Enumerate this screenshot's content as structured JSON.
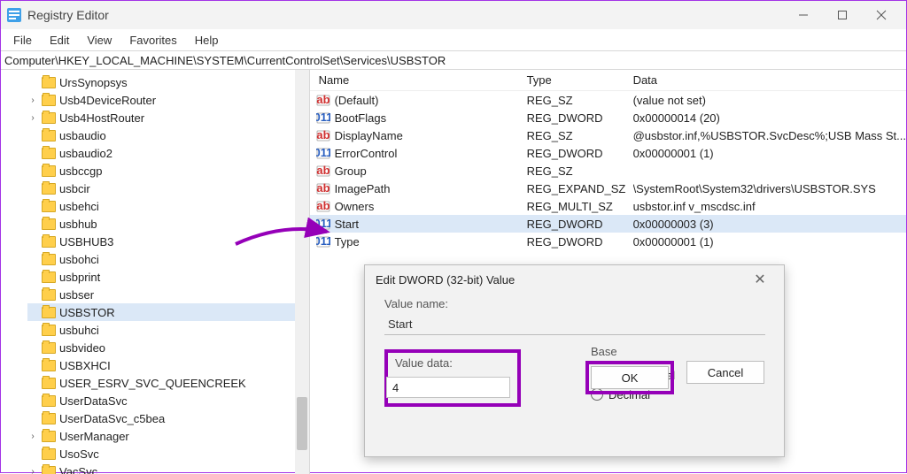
{
  "window": {
    "title": "Registry Editor",
    "menu": [
      "File",
      "Edit",
      "View",
      "Favorites",
      "Help"
    ],
    "address": "Computer\\HKEY_LOCAL_MACHINE\\SYSTEM\\CurrentControlSet\\Services\\USBSTOR"
  },
  "tree": {
    "items": [
      {
        "exp": false,
        "name": "UrsSynopsys"
      },
      {
        "exp": true,
        "name": "Usb4DeviceRouter"
      },
      {
        "exp": true,
        "name": "Usb4HostRouter"
      },
      {
        "exp": false,
        "name": "usbaudio"
      },
      {
        "exp": false,
        "name": "usbaudio2"
      },
      {
        "exp": false,
        "name": "usbccgp"
      },
      {
        "exp": false,
        "name": "usbcir"
      },
      {
        "exp": false,
        "name": "usbehci"
      },
      {
        "exp": false,
        "name": "usbhub"
      },
      {
        "exp": false,
        "name": "USBHUB3"
      },
      {
        "exp": false,
        "name": "usbohci"
      },
      {
        "exp": false,
        "name": "usbprint"
      },
      {
        "exp": false,
        "name": "usbser"
      },
      {
        "exp": false,
        "name": "USBSTOR",
        "selected": true
      },
      {
        "exp": false,
        "name": "usbuhci"
      },
      {
        "exp": false,
        "name": "usbvideo"
      },
      {
        "exp": false,
        "name": "USBXHCI"
      },
      {
        "exp": false,
        "name": "USER_ESRV_SVC_QUEENCREEK"
      },
      {
        "exp": false,
        "name": "UserDataSvc"
      },
      {
        "exp": false,
        "name": "UserDataSvc_c5bea"
      },
      {
        "exp": true,
        "name": "UserManager"
      },
      {
        "exp": false,
        "name": "UsoSvc"
      },
      {
        "exp": true,
        "name": "VacSvc"
      }
    ]
  },
  "list": {
    "headers": {
      "name": "Name",
      "type": "Type",
      "data": "Data"
    },
    "rows": [
      {
        "ico": "sz",
        "name": "(Default)",
        "type": "REG_SZ",
        "data": "(value not set)"
      },
      {
        "ico": "dw",
        "name": "BootFlags",
        "type": "REG_DWORD",
        "data": "0x00000014 (20)"
      },
      {
        "ico": "sz",
        "name": "DisplayName",
        "type": "REG_SZ",
        "data": "@usbstor.inf,%USBSTOR.SvcDesc%;USB Mass St..."
      },
      {
        "ico": "dw",
        "name": "ErrorControl",
        "type": "REG_DWORD",
        "data": "0x00000001 (1)"
      },
      {
        "ico": "sz",
        "name": "Group",
        "type": "REG_SZ",
        "data": ""
      },
      {
        "ico": "sz",
        "name": "ImagePath",
        "type": "REG_EXPAND_SZ",
        "data": "\\SystemRoot\\System32\\drivers\\USBSTOR.SYS"
      },
      {
        "ico": "sz",
        "name": "Owners",
        "type": "REG_MULTI_SZ",
        "data": "usbstor.inf v_mscdsc.inf"
      },
      {
        "ico": "dw",
        "name": "Start",
        "type": "REG_DWORD",
        "data": "0x00000003 (3)",
        "selected": true
      },
      {
        "ico": "dw",
        "name": "Type",
        "type": "REG_DWORD",
        "data": "0x00000001 (1)"
      }
    ]
  },
  "dialog": {
    "title": "Edit DWORD (32-bit) Value",
    "value_name_label": "Value name:",
    "value_name": "Start",
    "value_data_label": "Value data:",
    "value_data": "4",
    "base_label": "Base",
    "base_options": {
      "hex": "Hexadecimal",
      "dec": "Decimal"
    },
    "base_selected": "hex",
    "buttons": {
      "ok": "OK",
      "cancel": "Cancel"
    }
  }
}
